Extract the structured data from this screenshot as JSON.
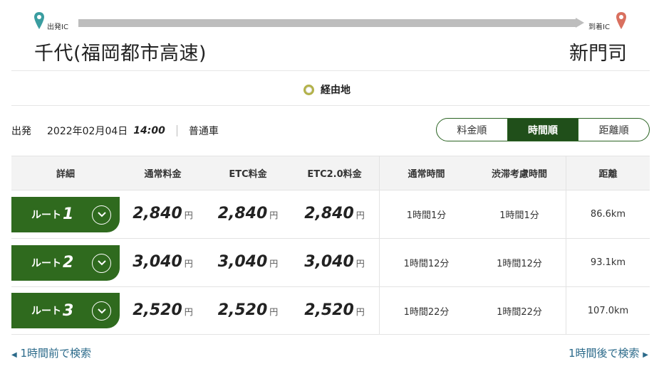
{
  "header": {
    "start_label": "出発IC",
    "end_label": "到着IC",
    "start_name": "千代(福岡都市高速)",
    "end_name": "新門司",
    "start_pin_color": "#3a9da0",
    "end_pin_color": "#d9705f"
  },
  "via": {
    "label": "経由地"
  },
  "conditions": {
    "label": "出発",
    "date": "2022年02月04日",
    "time": "14:00",
    "vehicle": "普通車"
  },
  "sort": {
    "options": [
      "料金順",
      "時間順",
      "距離順"
    ],
    "active": "時間順"
  },
  "table": {
    "headers": [
      "詳細",
      "通常料金",
      "ETC料金",
      "ETC2.0料金",
      "通常時間",
      "渋滞考慮時間",
      "距離"
    ],
    "yen": "円",
    "route_prefix": "ルート",
    "rows": [
      {
        "num": "1",
        "normal": "2,840",
        "etc": "2,840",
        "etc2": "2,840",
        "time": "1時間1分",
        "traffic_time": "1時間1分",
        "distance": "86.6km"
      },
      {
        "num": "2",
        "normal": "3,040",
        "etc": "3,040",
        "etc2": "3,040",
        "time": "1時間12分",
        "traffic_time": "1時間12分",
        "distance": "93.1km"
      },
      {
        "num": "3",
        "normal": "2,520",
        "etc": "2,520",
        "etc2": "2,520",
        "time": "1時間22分",
        "traffic_time": "1時間22分",
        "distance": "107.0km"
      }
    ]
  },
  "footer": {
    "prev": "1時間前で検索",
    "next": "1時間後で検索"
  },
  "colors": {
    "accent_green": "#2f6a1e",
    "link_blue": "#2b6a8a"
  }
}
